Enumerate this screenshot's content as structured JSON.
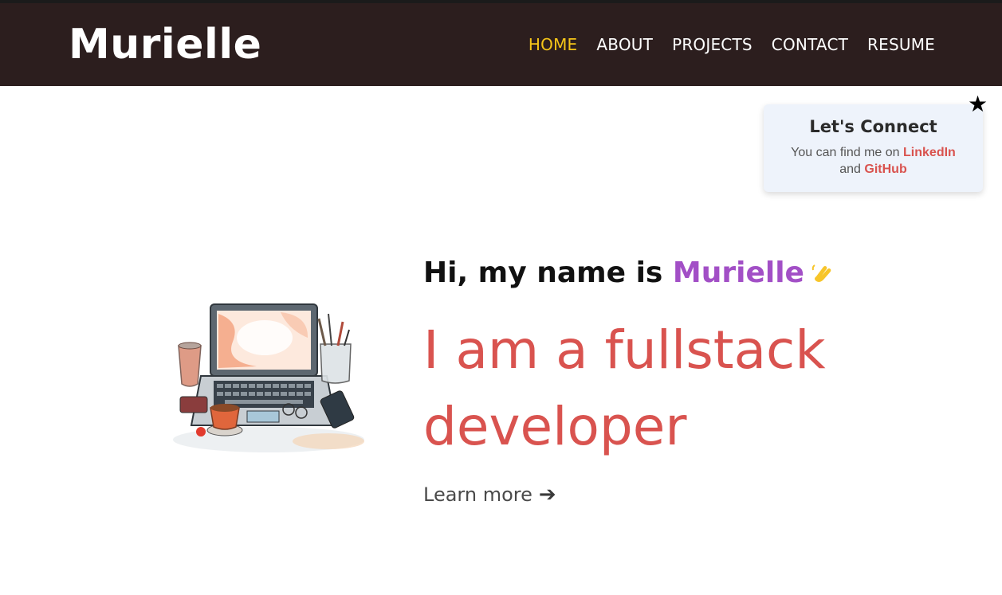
{
  "header": {
    "logo": "Murielle",
    "nav": [
      {
        "label": "HOME",
        "active": true
      },
      {
        "label": "ABOUT",
        "active": false
      },
      {
        "label": "PROJECTS",
        "active": false
      },
      {
        "label": "CONTACT",
        "active": false
      },
      {
        "label": "RESUME",
        "active": false
      }
    ]
  },
  "connect": {
    "title": "Let's Connect",
    "text_before": "You can find me on",
    "linkedin": "LinkedIn",
    "and": "and",
    "github": "GitHub"
  },
  "hero": {
    "greeting": "Hi, my name is",
    "name": "Murielle",
    "headline": "I am a fullstack developer",
    "learn_more": "Learn more",
    "arrow": "➔"
  },
  "icons": {
    "star": "★",
    "wave": "waving-hand-icon",
    "illustration": "laptop-desk-illustration"
  },
  "colors": {
    "header_bg": "#2c1e1e",
    "nav_active": "#f5c518",
    "accent_red": "#d9534f",
    "name_purple": "#a24fc6",
    "card_bg": "#eef3fb"
  }
}
